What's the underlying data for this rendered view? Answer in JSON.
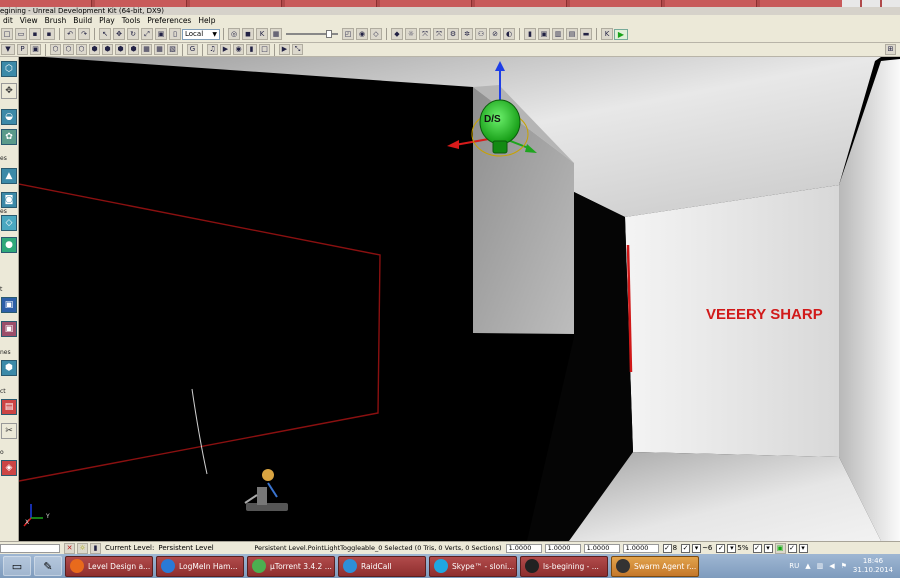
{
  "window": {
    "title": "egining - Unreal Development Kit (64-bit, DX9)",
    "controls": [
      "–",
      "□",
      "✕"
    ]
  },
  "browser_tabs": [
    "",
    "",
    "",
    "",
    "",
    "",
    "",
    "",
    ""
  ],
  "menu": [
    "dit",
    "View",
    "Brush",
    "Build",
    "Play",
    "Tools",
    "Preferences",
    "Help"
  ],
  "toolbar1": {
    "coord_system": "Local",
    "play_icon": "play-icon"
  },
  "toolbar2": {
    "label_p": "P",
    "label_g": "G"
  },
  "left_toolbar": {
    "group_labels": [
      "es",
      "es",
      "t",
      "nes",
      "ct",
      "o"
    ]
  },
  "viewport": {
    "light_label": "D/S",
    "annotation": "VEEERY SHARP",
    "axis_x": "X",
    "axis_y": "Y"
  },
  "statusbar": {
    "current_level_label": "Current Level:",
    "current_level_value": "Persistent Level",
    "selection": "Persistent Level.PointLightToggleable_0 Selected (0 Tris, 0 Verts, 0 Sections)",
    "drag_grid": [
      "1.0000",
      "1.0000",
      "1.0000",
      "1.0000"
    ],
    "grid_size": "8",
    "rotation_snap": "~6",
    "scale_snap": "5%"
  },
  "taskbar": {
    "tasks": [
      {
        "label": "Level Design a...",
        "color": "#e86a1c",
        "active": false
      },
      {
        "label": "LogMeIn Ham...",
        "color": "#2a7ad6",
        "active": false
      },
      {
        "label": "µTorrent 3.4.2 ...",
        "color": "#4caf50",
        "active": false
      },
      {
        "label": "RaidCall",
        "color": "#2d8fd8",
        "active": false
      },
      {
        "label": "Skype™ - sloni...",
        "color": "#1ea7e1",
        "active": false
      },
      {
        "label": "ls-begining - ...",
        "color": "#222222",
        "active": false
      },
      {
        "label": "Swarm Agent r...",
        "color": "#333333",
        "active": true
      }
    ],
    "language": "RU",
    "time": "18:46",
    "date": "31.10.2014"
  },
  "colors": {
    "annotation_red": "#d11a1a",
    "bsp_red_line": "#8a1010",
    "light_green": "#1fb31f",
    "gizmo_blue": "#1e3ee6",
    "taskbar_task": "#a33c3c"
  }
}
